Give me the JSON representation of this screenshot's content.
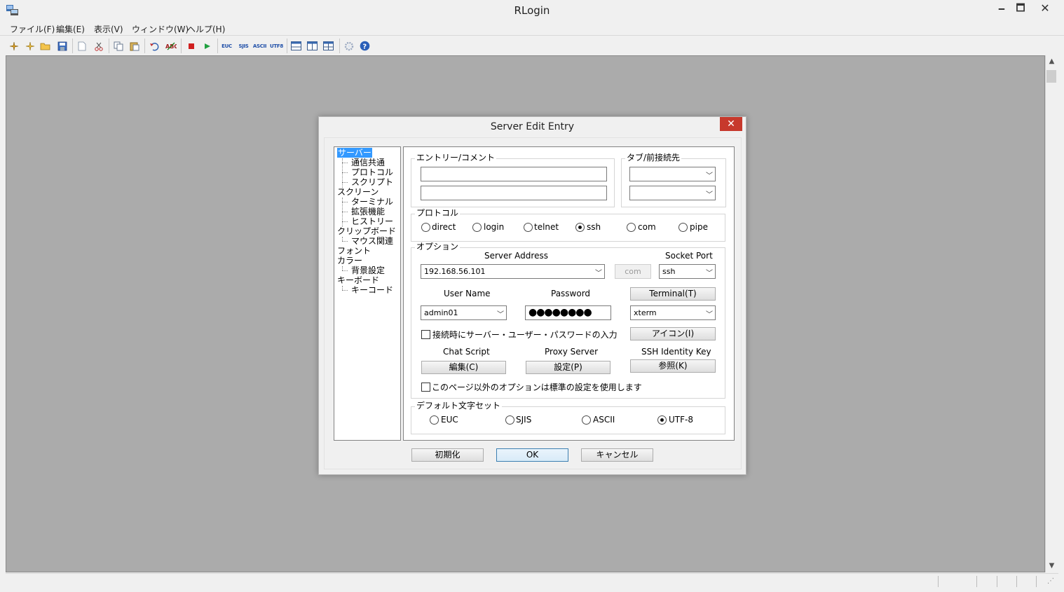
{
  "app": {
    "title": "RLogin",
    "minimize": "🗕",
    "maximize": "🗖",
    "close": "✕"
  },
  "menu": [
    "ファイル(F)",
    "編集(E)",
    "表示(V)",
    "ウィンドウ(W)",
    "ヘルプ(H)"
  ],
  "toolbar": {
    "charsets": [
      "EUC",
      "SJIS",
      "ASCII",
      "UTF8"
    ],
    "icon_names": [
      "new-connection-icon",
      "connect-icon",
      "open-folder-icon",
      "save-icon",
      "new-document-icon",
      "cut-icon",
      "copy-icon",
      "paste-icon",
      "undo-icon",
      "spellcheck-icon",
      "stop-icon",
      "play-icon",
      "euc-icon",
      "sjis-icon",
      "ascii-icon",
      "utf8-icon",
      "split-horizontal-icon",
      "split-vertical-icon",
      "split-full-icon",
      "settings-gear-icon",
      "help-icon"
    ]
  },
  "dialog": {
    "title": "Server Edit Entry",
    "close": "✕",
    "tree": [
      {
        "label": "サーバー",
        "level": 0,
        "selected": true
      },
      {
        "label": "通信共通",
        "level": 1
      },
      {
        "label": "プロトコル",
        "level": 1
      },
      {
        "label": "スクリプト",
        "level": 1
      },
      {
        "label": "スクリーン",
        "level": 0
      },
      {
        "label": "ターミナル",
        "level": 1
      },
      {
        "label": "拡張機能",
        "level": 1
      },
      {
        "label": "ヒストリー",
        "level": 1
      },
      {
        "label": "クリップボード",
        "level": 0
      },
      {
        "label": "マウス関連",
        "level": 1
      },
      {
        "label": "フォント",
        "level": 0
      },
      {
        "label": "カラー",
        "level": 0
      },
      {
        "label": "背景設定",
        "level": 1
      },
      {
        "label": "キーボード",
        "level": 0
      },
      {
        "label": "キーコード",
        "level": 1
      }
    ],
    "entry_group": {
      "label": "エントリー/コメント",
      "entry_value": "",
      "comment_value": ""
    },
    "tab_group": {
      "label": "タブ/前接続先",
      "tab_value": "",
      "prev_value": ""
    },
    "protocol_group": {
      "label": "プロトコル",
      "options": [
        "direct",
        "login",
        "telnet",
        "ssh",
        "com",
        "pipe"
      ],
      "selected": "ssh"
    },
    "option_group": {
      "label": "オプション",
      "server_address_label": "Server Address",
      "server_address_value": "192.168.56.101",
      "com_label": "com",
      "socket_port_label": "Socket Port",
      "socket_port_value": "ssh",
      "user_name_label": "User Name",
      "user_name_value": "admin01",
      "password_label": "Password",
      "password_mask": "●●●●●●●●",
      "terminal_button": "Terminal(T)",
      "terminal_value": "xterm",
      "prompt_checkbox_label": "接続時にサーバー・ユーザー・パスワードの入力",
      "prompt_checked": false,
      "icon_button": "アイコン(I)",
      "chat_script_label": "Chat Script",
      "chat_script_button": "編集(C)",
      "proxy_label": "Proxy Server",
      "proxy_button": "設定(P)",
      "ssh_key_label": "SSH Identity Key",
      "ssh_key_button": "参照(K)",
      "default_options_label": "このページ以外のオプションは標準の設定を使用します",
      "default_options_checked": false
    },
    "charset_group": {
      "label": "デフォルト文字セット",
      "options": [
        "EUC",
        "SJIS",
        "ASCII",
        "UTF-8"
      ],
      "selected": "UTF-8"
    },
    "buttons": {
      "reset": "初期化",
      "ok": "OK",
      "cancel": "キャンセル"
    }
  },
  "scrollbar": {
    "up": "▲",
    "down": "▼"
  }
}
